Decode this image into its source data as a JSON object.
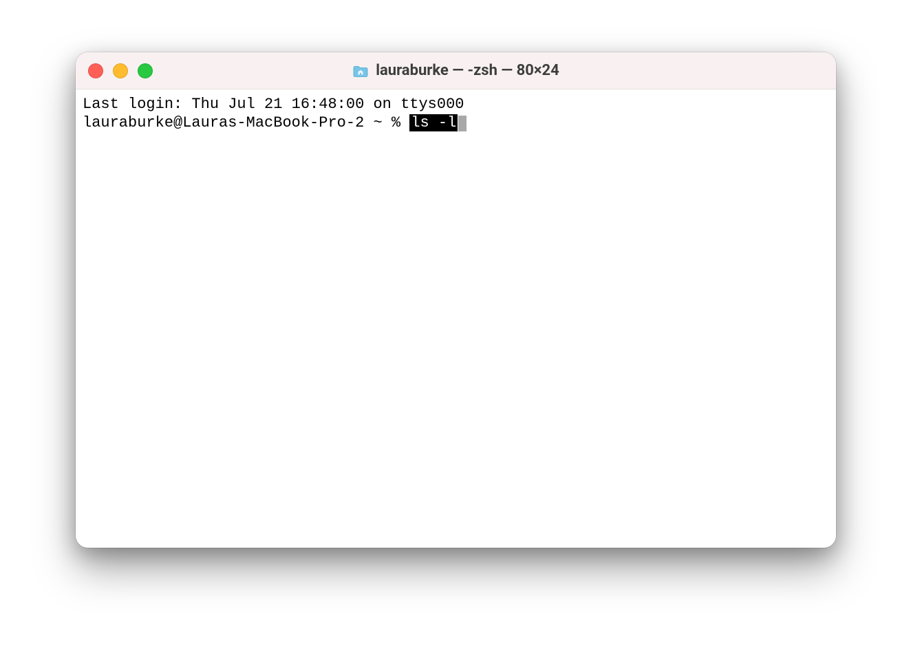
{
  "window": {
    "title_icon": "home-folder-icon",
    "title": "lauraburke — -zsh — 80×24",
    "traffic_light_colors": {
      "close": "#ff5f57",
      "minimize": "#febc2e",
      "zoom": "#28c840"
    }
  },
  "terminal": {
    "last_login_line": "Last login: Thu Jul 21 16:48:00 on ttys000",
    "prompt": "lauraburke@Lauras-MacBook-Pro-2 ~ % ",
    "typed_command": "ls -l"
  }
}
